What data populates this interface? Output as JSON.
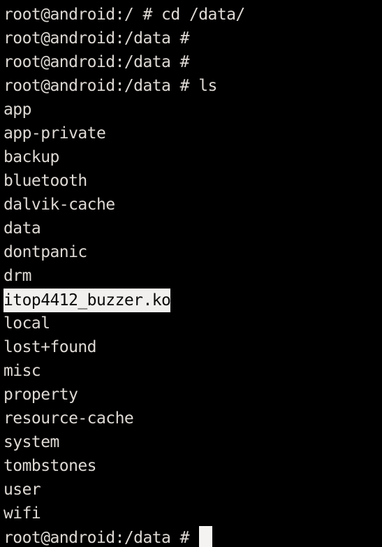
{
  "terminal": {
    "colors": {
      "background": "#000000",
      "foreground": "#ded9d4",
      "selection_background": "#f2f0ee",
      "selection_foreground": "#0a0a0a",
      "cursor": "#f5f3f1"
    },
    "prompt_user": "root",
    "prompt_host": "android",
    "lines": [
      {
        "text": "root@android:/ # cd /data/",
        "type": "prompt-command",
        "highlighted": false
      },
      {
        "text": "root@android:/data #",
        "type": "prompt",
        "highlighted": false
      },
      {
        "text": "root@android:/data #",
        "type": "prompt",
        "highlighted": false
      },
      {
        "text": "root@android:/data # ls",
        "type": "prompt-command",
        "highlighted": false
      },
      {
        "text": "app",
        "type": "output",
        "highlighted": false
      },
      {
        "text": "app-private",
        "type": "output",
        "highlighted": false
      },
      {
        "text": "backup",
        "type": "output",
        "highlighted": false
      },
      {
        "text": "bluetooth",
        "type": "output",
        "highlighted": false
      },
      {
        "text": "dalvik-cache",
        "type": "output",
        "highlighted": false
      },
      {
        "text": "data",
        "type": "output",
        "highlighted": false
      },
      {
        "text": "dontpanic",
        "type": "output",
        "highlighted": false
      },
      {
        "text": "drm",
        "type": "output",
        "highlighted": false
      },
      {
        "text": "itop4412_buzzer.ko",
        "type": "output",
        "highlighted": true
      },
      {
        "text": "local",
        "type": "output",
        "highlighted": false
      },
      {
        "text": "lost+found",
        "type": "output",
        "highlighted": false
      },
      {
        "text": "misc",
        "type": "output",
        "highlighted": false
      },
      {
        "text": "property",
        "type": "output",
        "highlighted": false
      },
      {
        "text": "resource-cache",
        "type": "output",
        "highlighted": false
      },
      {
        "text": "system",
        "type": "output",
        "highlighted": false
      },
      {
        "text": "tombstones",
        "type": "output",
        "highlighted": false
      },
      {
        "text": "user",
        "type": "output",
        "highlighted": false
      },
      {
        "text": "wifi",
        "type": "output",
        "highlighted": false
      }
    ],
    "last_prompt": {
      "text": "root@android:/data # ",
      "cursor": "block"
    }
  }
}
